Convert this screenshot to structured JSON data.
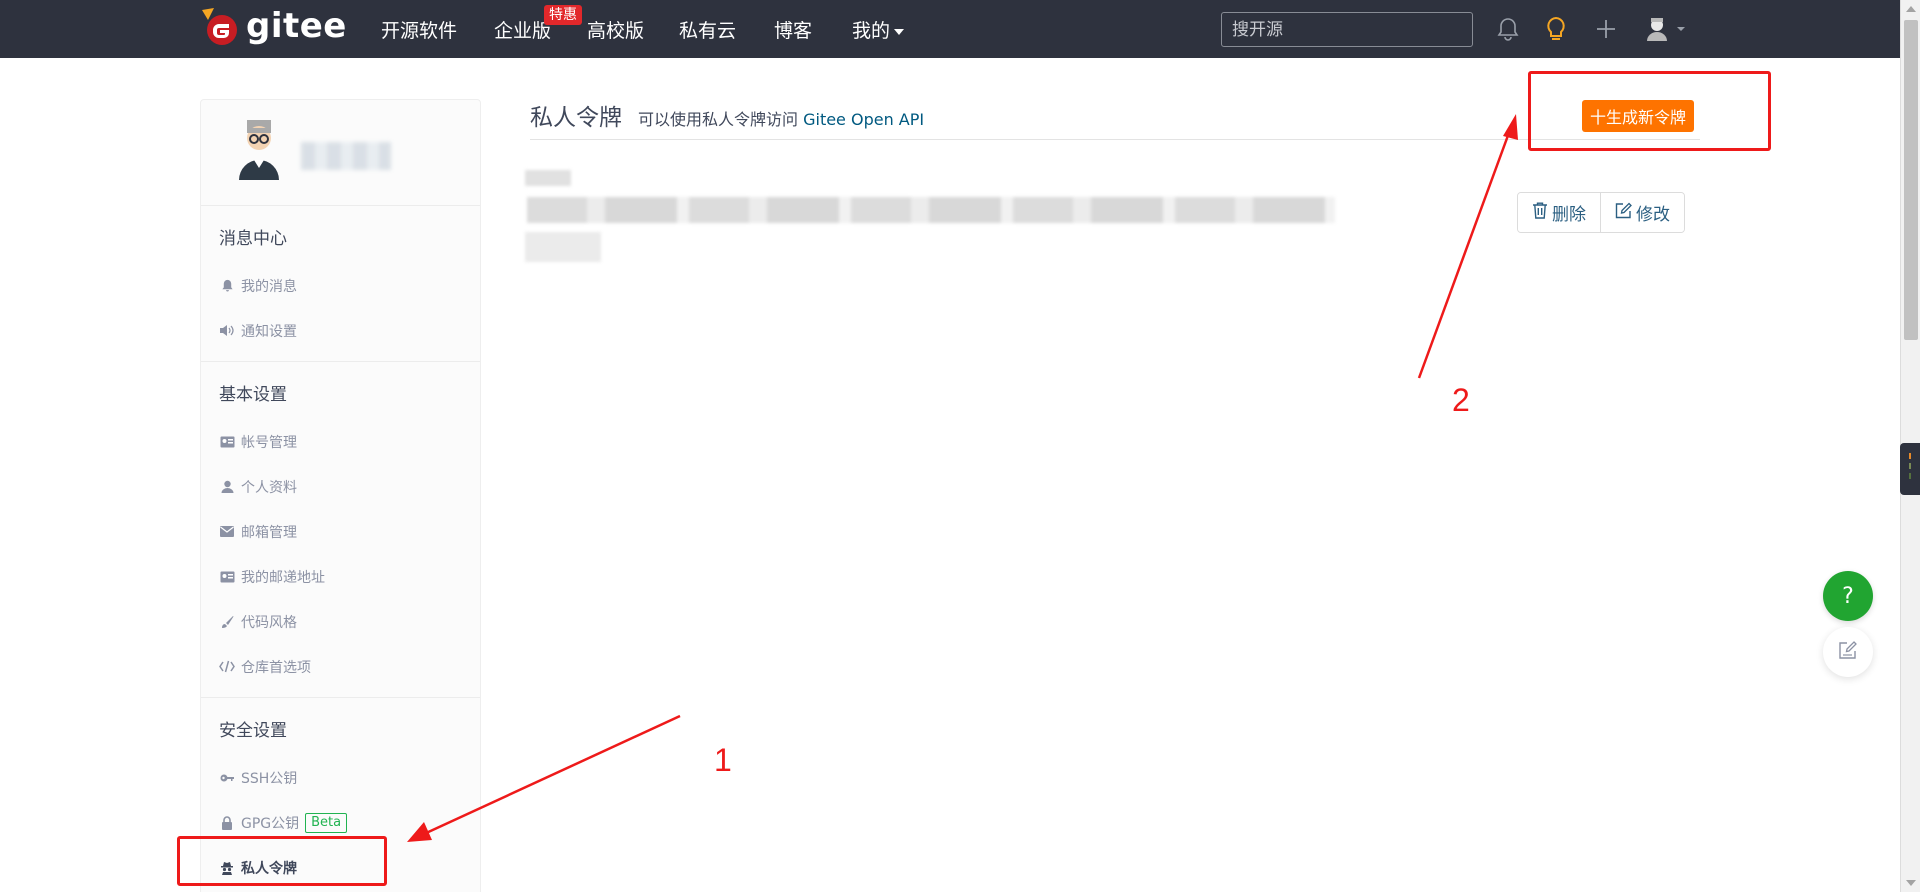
{
  "navbar": {
    "logo_text": "gitee",
    "items": [
      {
        "label": "开源软件"
      },
      {
        "label": "企业版"
      },
      {
        "label": "高校版"
      },
      {
        "label": "私有云"
      },
      {
        "label": "博客"
      },
      {
        "label": "我的"
      }
    ],
    "badge": "特惠",
    "search_placeholder": "搜开源",
    "icons": [
      "bell-icon",
      "lightbulb-icon",
      "plus-icon",
      "user-avatar-icon"
    ]
  },
  "sidebar": {
    "sections": [
      {
        "title": "消息中心",
        "items": [
          {
            "label": "我的消息",
            "icon": "bell-icon"
          },
          {
            "label": "通知设置",
            "icon": "speaker-icon"
          }
        ]
      },
      {
        "title": "基本设置",
        "items": [
          {
            "label": "帐号管理",
            "icon": "id-card-icon"
          },
          {
            "label": "个人资料",
            "icon": "user-icon"
          },
          {
            "label": "邮箱管理",
            "icon": "envelope-icon"
          },
          {
            "label": "我的邮递地址",
            "icon": "id-card-icon"
          },
          {
            "label": "代码风格",
            "icon": "brush-icon"
          },
          {
            "label": "仓库首选项",
            "icon": "code-icon"
          }
        ]
      },
      {
        "title": "安全设置",
        "items": [
          {
            "label": "SSH公钥",
            "icon": "key-icon"
          },
          {
            "label": "GPG公钥",
            "icon": "lock-icon",
            "badge": "Beta"
          },
          {
            "label": "私人令牌",
            "icon": "spy-icon",
            "active": true
          }
        ]
      }
    ]
  },
  "main": {
    "title": "私人令牌",
    "description_prefix": "可以使用私人令牌访问 ",
    "description_link": "Gitee Open API",
    "generate_button": "十生成新令牌",
    "delete_button": "删除",
    "edit_button": "修改"
  },
  "annotations": {
    "label_1": "1",
    "label_2": "2",
    "color": "#ee1a1a"
  },
  "floating": {
    "help_label": "?"
  },
  "colors": {
    "navbar_bg": "#2e323e",
    "accent_orange": "#fe7300",
    "link_blue": "#005980",
    "beta_green": "#21b351",
    "help_green": "#21a531"
  }
}
